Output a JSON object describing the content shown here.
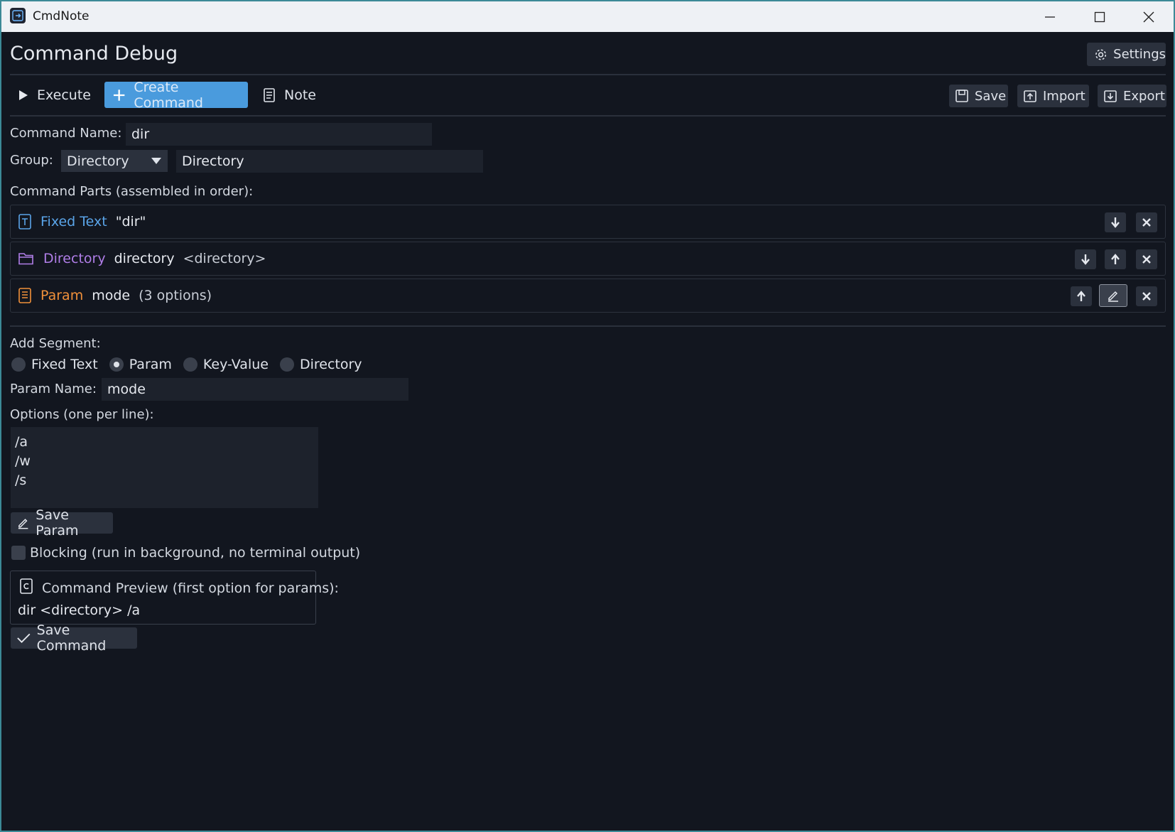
{
  "window": {
    "title": "CmdNote"
  },
  "header": {
    "title": "Command Debug",
    "settings_label": "Settings"
  },
  "toolbar": {
    "execute_label": "Execute",
    "create_label": "Create Command",
    "note_label": "Note",
    "save_label": "Save",
    "import_label": "Import",
    "export_label": "Export",
    "active_tab": "Create Command",
    "accent_color": "#4a9bdd"
  },
  "form": {
    "command_name_label": "Command Name:",
    "command_name_value": "dir",
    "group_label": "Group:",
    "group_selected": "Directory",
    "group_input_value": "Directory",
    "parts_label": "Command Parts (assembled in order):"
  },
  "segments": [
    {
      "type": "Fixed Text",
      "value": "\"dir\"",
      "extra": "",
      "icon": "text-file-icon",
      "color": "#5aa4e8"
    },
    {
      "type": "Directory",
      "value": "directory",
      "extra": "<directory>",
      "icon": "folder-icon",
      "color": "#b07ee8"
    },
    {
      "type": "Param",
      "value": "mode",
      "extra": "(3 options)",
      "icon": "list-icon",
      "color": "#f0903a"
    }
  ],
  "add_segment": {
    "label": "Add Segment:",
    "options": [
      "Fixed Text",
      "Param",
      "Key-Value",
      "Directory"
    ],
    "selected": "Param",
    "param_name_label": "Param Name:",
    "param_name_value": "mode",
    "options_label": "Options (one per line):",
    "options_text": "/a\n/w\n/s",
    "save_param_label": "Save Param"
  },
  "blocking": {
    "label": "Blocking (run in background, no terminal output)",
    "checked": false
  },
  "preview": {
    "label": "Command Preview (first option for params):",
    "value": "dir <directory> /a"
  },
  "save_command_label": "Save Command"
}
